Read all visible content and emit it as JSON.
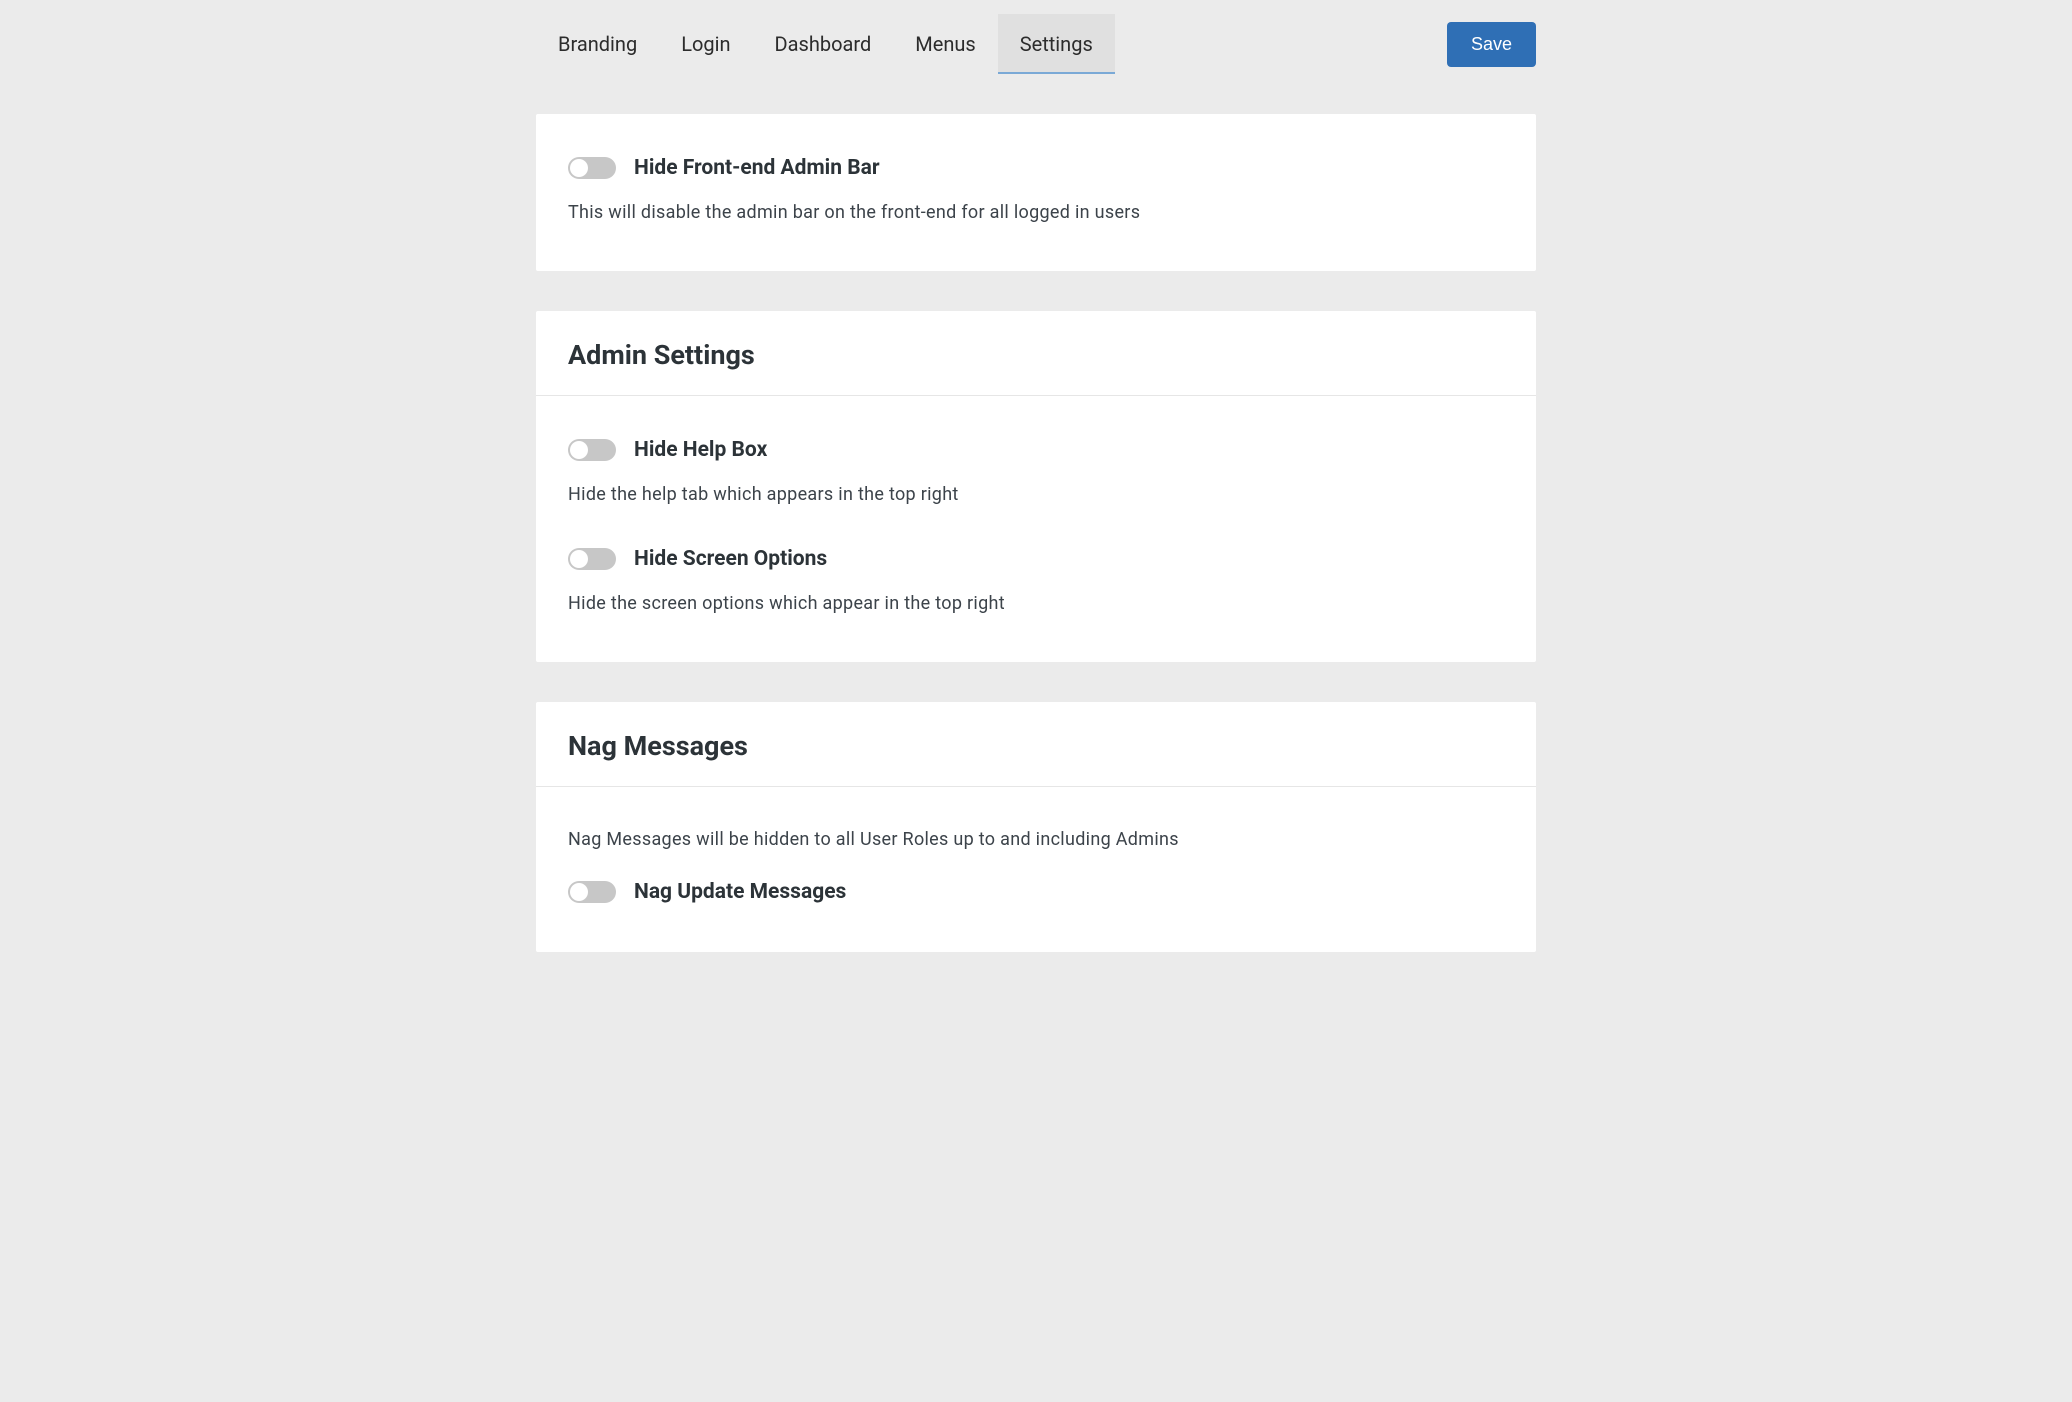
{
  "tabs": {
    "branding": "Branding",
    "login": "Login",
    "dashboard": "Dashboard",
    "menus": "Menus",
    "settings": "Settings"
  },
  "save_label": "Save",
  "panel1": {
    "opt1": {
      "title": "Hide Front-end Admin Bar",
      "desc": "This will disable the admin bar on the front-end for all logged in users"
    }
  },
  "panel2": {
    "heading": "Admin Settings",
    "opt1": {
      "title": "Hide Help Box",
      "desc": "Hide the help tab which appears in the top right"
    },
    "opt2": {
      "title": "Hide Screen Options",
      "desc": "Hide the screen options which appear in the top right"
    }
  },
  "panel3": {
    "heading": "Nag Messages",
    "lead": "Nag Messages will be hidden to all User Roles up to and including Admins",
    "opt1": {
      "title": "Nag Update Messages"
    }
  }
}
